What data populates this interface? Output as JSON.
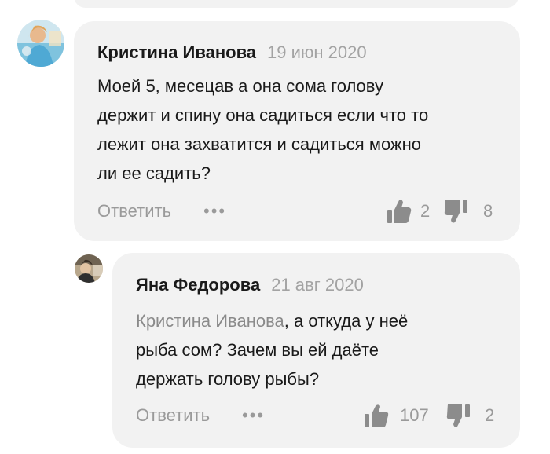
{
  "comments": [
    {
      "author": "Кристина Иванова",
      "date": "19 июн 2020",
      "lines": [
        "Моей 5, месецав а она сома голову",
        "держит и спину она садиться если что то",
        "лежит она захватится и садиться можно",
        "ли ее садить?"
      ],
      "reply_label": "Ответить",
      "more_label": "•••",
      "likes": "2",
      "dislikes": "8"
    },
    {
      "author": "Яна Федорова",
      "date": "21 авг 2020",
      "mention": "Кристина Иванова",
      "lines": [
        ", а откуда у неё",
        "рыба сом? Зачем вы ей даёте",
        "держать голову рыбы?"
      ],
      "reply_label": "Ответить",
      "more_label": "•••",
      "likes": "107",
      "dislikes": "2"
    }
  ],
  "colors": {
    "card_bg": "#f2f2f2",
    "text": "#1a1a1a",
    "muted": "#9a9a9a",
    "icon": "#8c8c8c"
  },
  "icons": [
    "thumbs-up-icon",
    "thumbs-down-icon",
    "more-dots-icon"
  ]
}
